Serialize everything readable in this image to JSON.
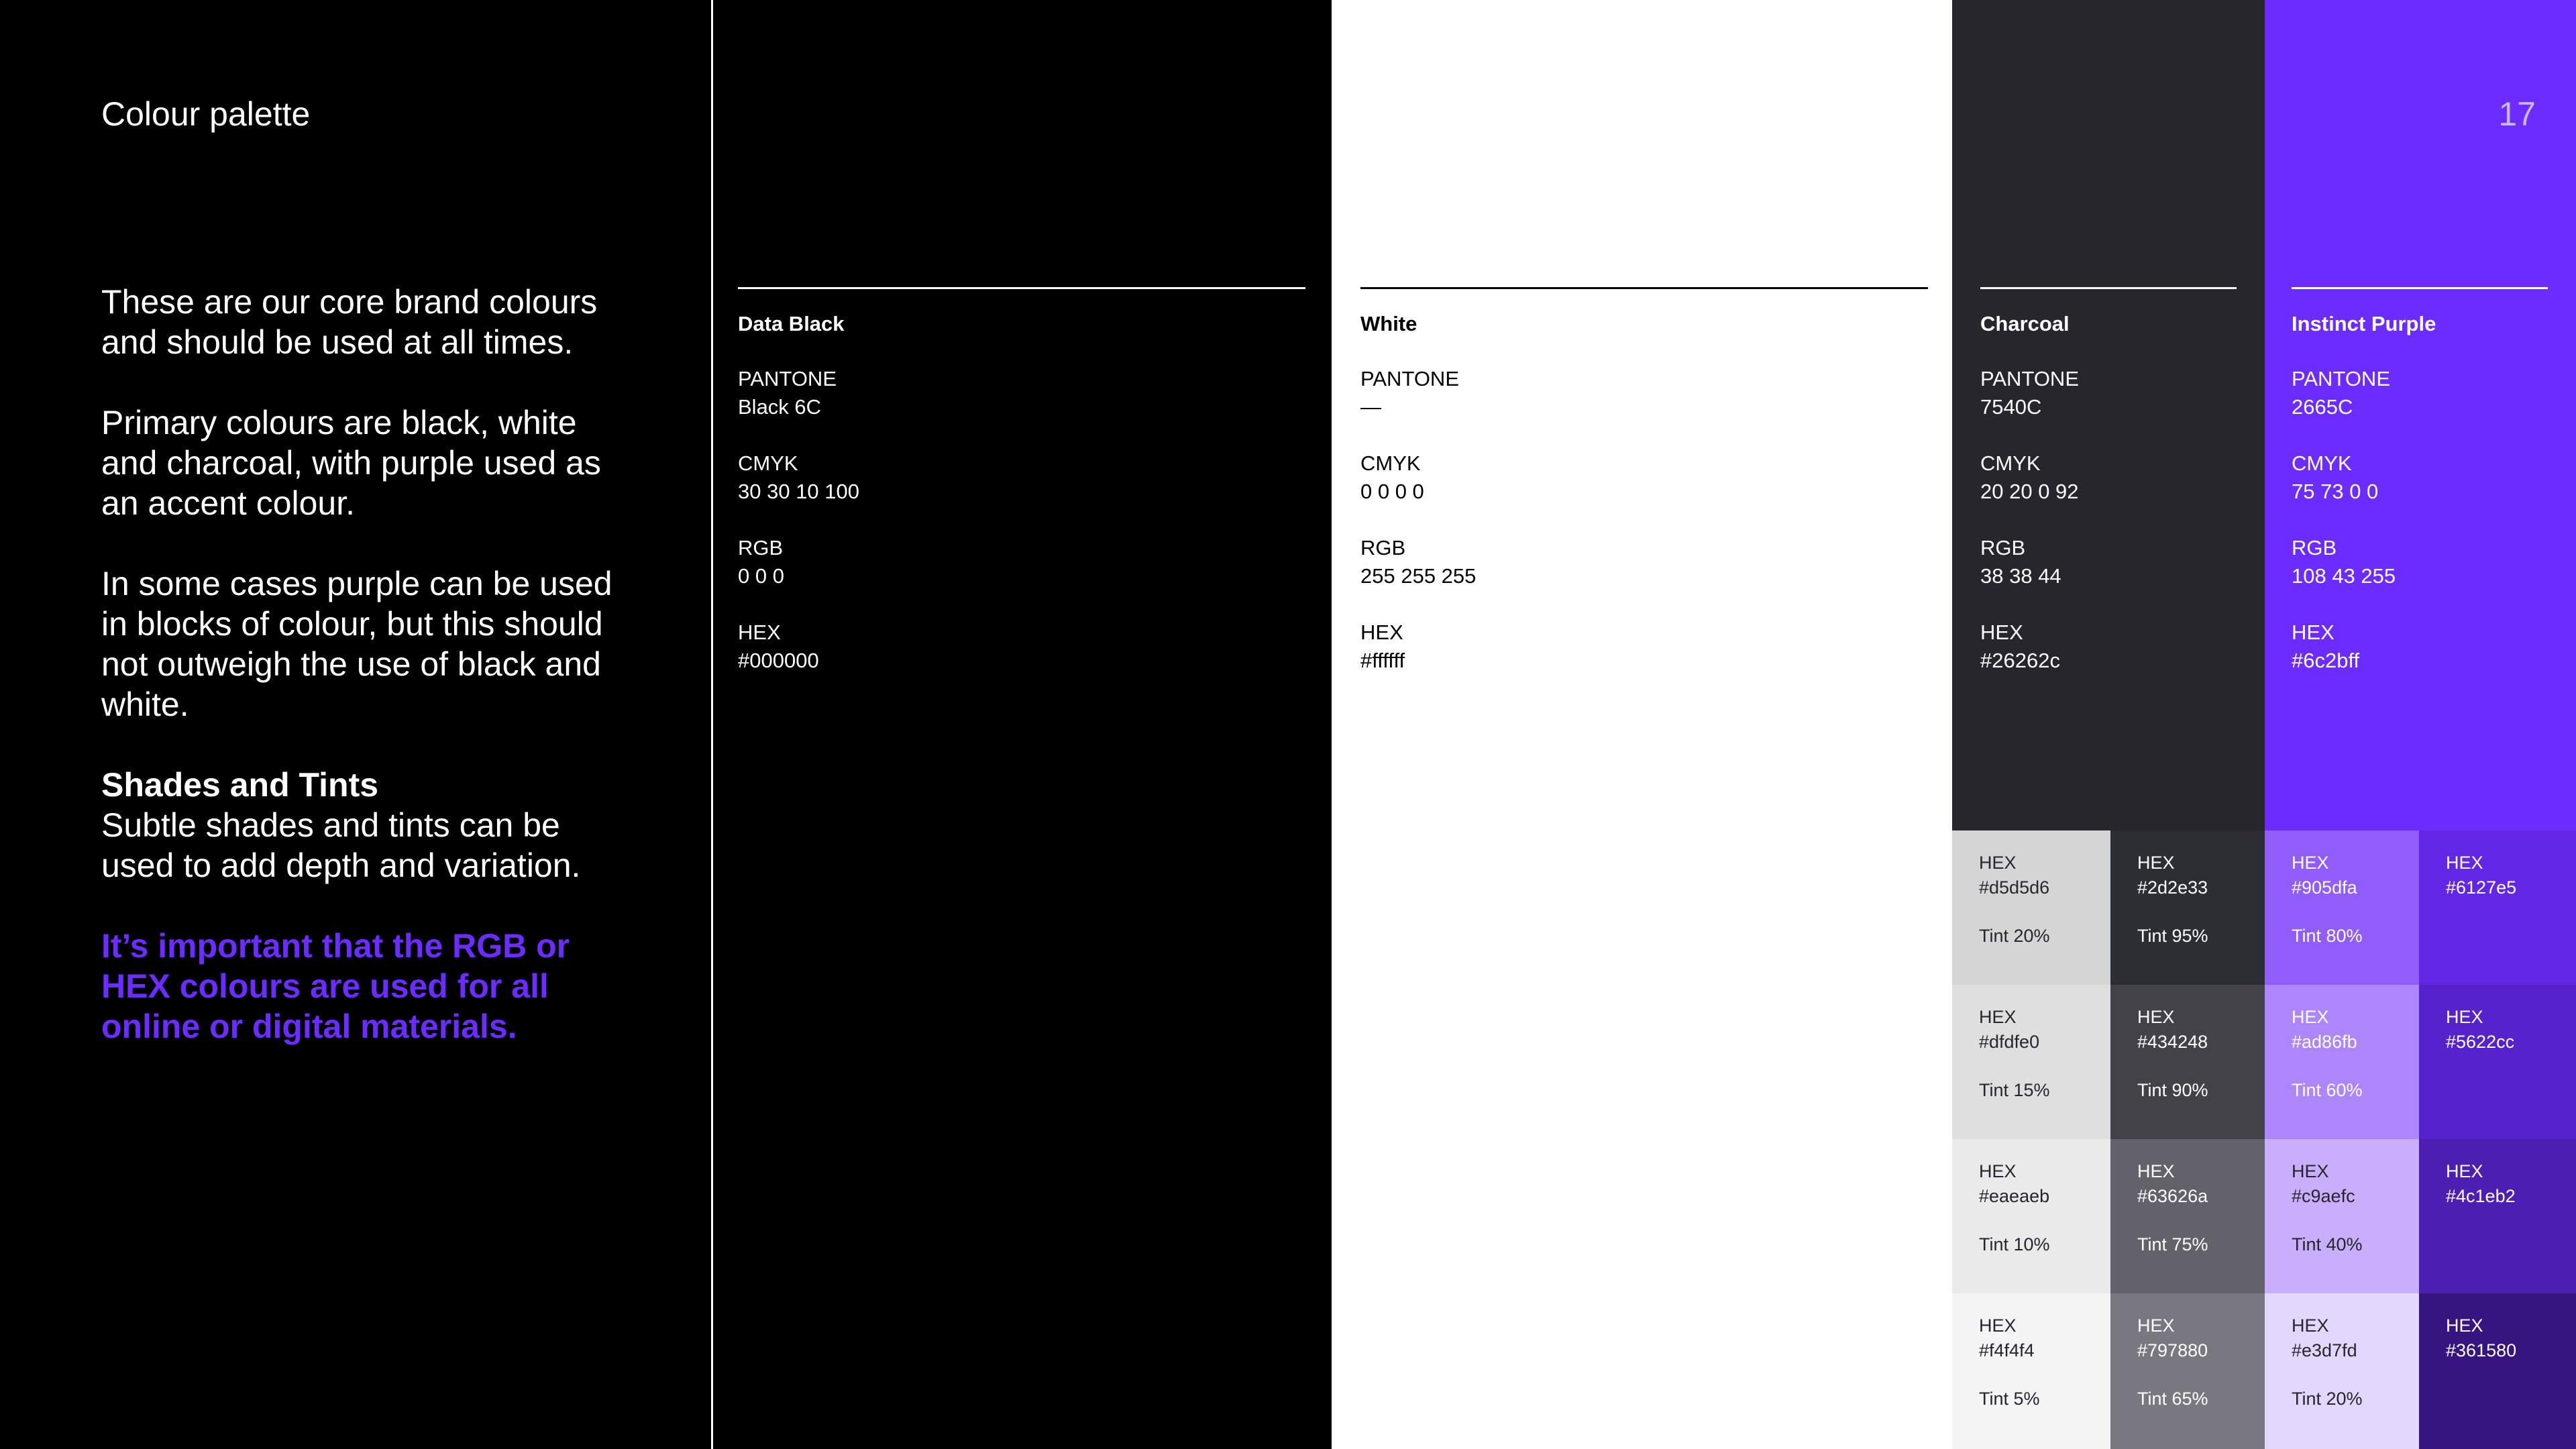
{
  "header": {
    "title": "Colour palette",
    "page_number": "17"
  },
  "intro": {
    "p1": "These are our core brand colours and should be used at all times.",
    "p2": "Primary colours are black, white and charcoal, with purple used as an accent colour.",
    "p3": "In some cases purple can be used in blocks of colour, but this should not outweigh the use of black and white.",
    "shades_title": "Shades and Tints",
    "shades_text": "Subtle shades and tints can be used to add depth and variation.",
    "important": "It’s important that the RGB or HEX colours are used for all online or digital materials."
  },
  "colours": [
    {
      "name": "Data Black",
      "pantone_label": "PANTONE",
      "pantone": "Black 6C",
      "cmyk_label": "CMYK",
      "cmyk": "30  30  10  100",
      "rgb_label": "RGB",
      "rgb": "0 0 0",
      "hex_label": "HEX",
      "hex": "#000000",
      "bg": "#000000",
      "fg": "#ffffff"
    },
    {
      "name": "White",
      "pantone_label": "PANTONE",
      "pantone": "—",
      "cmyk_label": "CMYK",
      "cmyk": "0  0  0  0",
      "rgb_label": "RGB",
      "rgb": "255  255  255",
      "hex_label": "HEX",
      "hex": "#ffffff",
      "bg": "#ffffff",
      "fg": "#000000"
    },
    {
      "name": "Charcoal",
      "pantone_label": "PANTONE",
      "pantone": "7540C",
      "cmyk_label": "CMYK",
      "cmyk": "20  20  0  92",
      "rgb_label": "RGB",
      "rgb": "38  38  44",
      "hex_label": "HEX",
      "hex": "#26262c",
      "bg": "#26262c",
      "fg": "#ffffff"
    },
    {
      "name": "Instinct Purple",
      "pantone_label": "PANTONE",
      "pantone": "2665C",
      "cmyk_label": "CMYK",
      "cmyk": "75  73  0  0",
      "rgb_label": "RGB",
      "rgb": "108  43  255",
      "hex_label": "HEX",
      "hex": "#6c2bff",
      "bg": "#6c2bff",
      "fg": "#ffffff"
    }
  ],
  "swatches": [
    [
      {
        "hex_label": "HEX",
        "hex": "#d5d5d6",
        "tint": "Tint 20%",
        "bg": "#d5d5d6",
        "fg": "#26262c"
      },
      {
        "hex_label": "HEX",
        "hex": "#2d2e33",
        "tint": "Tint 95%",
        "bg": "#2d2e33",
        "fg": "#ffffff"
      },
      {
        "hex_label": "HEX",
        "hex": "#905dfa",
        "tint": "Tint 80%",
        "bg": "#905dfa",
        "fg": "#ffffff"
      },
      {
        "hex_label": "HEX",
        "hex": "#6127e5",
        "tint": "",
        "bg": "#6127e5",
        "fg": "#ffffff"
      }
    ],
    [
      {
        "hex_label": "HEX",
        "hex": "#dfdfe0",
        "tint": "Tint 15%",
        "bg": "#dfdfe0",
        "fg": "#26262c"
      },
      {
        "hex_label": "HEX",
        "hex": "#434248",
        "tint": "Tint 90%",
        "bg": "#434248",
        "fg": "#ffffff"
      },
      {
        "hex_label": "HEX",
        "hex": "#ad86fb",
        "tint": "Tint 60%",
        "bg": "#ad86fb",
        "fg": "#ffffff"
      },
      {
        "hex_label": "HEX",
        "hex": "#5622cc",
        "tint": "",
        "bg": "#5622cc",
        "fg": "#ffffff"
      }
    ],
    [
      {
        "hex_label": "HEX",
        "hex": "#eaeaeb",
        "tint": "Tint 10%",
        "bg": "#eaeaeb",
        "fg": "#26262c"
      },
      {
        "hex_label": "HEX",
        "hex": "#63626a",
        "tint": "Tint 75%",
        "bg": "#63626a",
        "fg": "#ffffff"
      },
      {
        "hex_label": "HEX",
        "hex": "#c9aefc",
        "tint": "Tint 40%",
        "bg": "#c9aefc",
        "fg": "#26262c"
      },
      {
        "hex_label": "HEX",
        "hex": "#4c1eb2",
        "tint": "",
        "bg": "#4c1eb2",
        "fg": "#ffffff"
      }
    ],
    [
      {
        "hex_label": "HEX",
        "hex": "#f4f4f4",
        "tint": "Tint 5%",
        "bg": "#f4f4f4",
        "fg": "#26262c"
      },
      {
        "hex_label": "HEX",
        "hex": "#797880",
        "tint": "Tint 65%",
        "bg": "#797880",
        "fg": "#ffffff"
      },
      {
        "hex_label": "HEX",
        "hex": "#e3d7fd",
        "tint": "Tint 20%",
        "bg": "#e3d7fd",
        "fg": "#26262c"
      },
      {
        "hex_label": "HEX",
        "hex": "#361580",
        "tint": "",
        "bg": "#361580",
        "fg": "#ffffff"
      }
    ]
  ]
}
